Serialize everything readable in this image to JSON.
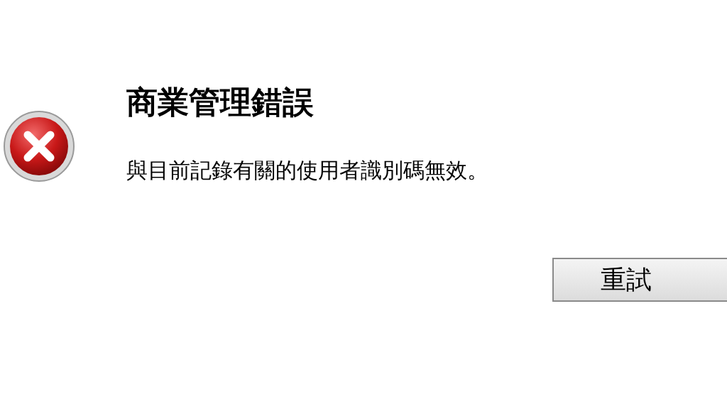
{
  "dialog": {
    "kind": "error",
    "title": "商業管理錯誤",
    "message": "與目前記錄有關的使用者識別碼無效。",
    "buttons": [
      "重試"
    ]
  }
}
